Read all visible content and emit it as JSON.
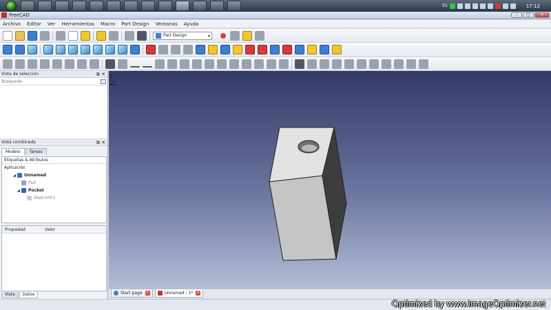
{
  "taskbar": {
    "language": "ES",
    "time": "17:12"
  },
  "window": {
    "title": "FreeCAD",
    "min": "–",
    "max": "□",
    "close": "✕"
  },
  "menu": [
    "Archivo",
    "Editar",
    "Ver",
    "Herramientas",
    "Macro",
    "Part Design",
    "Ventanas",
    "Ayuda"
  ],
  "toolbar": {
    "workbench": "Part Design"
  },
  "selection_panel": {
    "title": "Vista de selección",
    "search_placeholder": "Búsqueda"
  },
  "combo_view": {
    "title": "Vista combinada",
    "tabs": [
      "Modelo",
      "Tareas"
    ],
    "tree_header": "Etiquetas & Atributos",
    "tree": {
      "root": "Aplicación",
      "document": "Unnamed",
      "pad": "Pad",
      "pocket": "Pocket",
      "sketch": "Sketch001"
    },
    "props_columns": [
      "Propiedad",
      "Valor"
    ],
    "bottom_tabs": [
      "Vista",
      "Datos"
    ]
  },
  "doc_tabs": [
    "Start page",
    "Unnamed : 1*"
  ],
  "watermark": "Optimized by www.ImageOptimizer.net",
  "colors": {
    "view_top": "#343a67",
    "view_bottom": "#b4bdd6",
    "solid_front": "#c5c5c5",
    "solid_side": "#3d3d3d",
    "solid_top": "#e2e2e2"
  }
}
